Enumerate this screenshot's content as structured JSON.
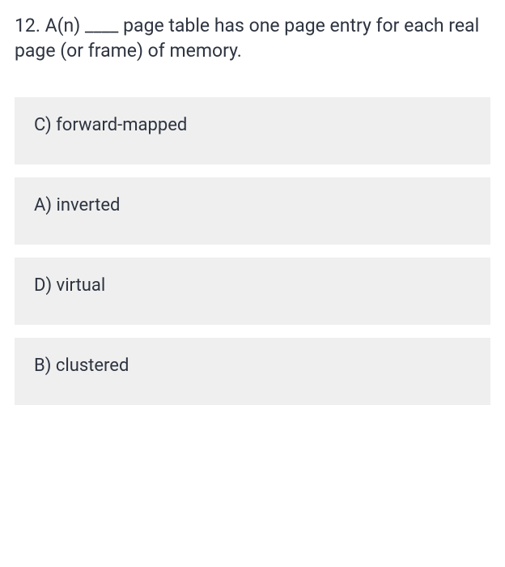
{
  "question": {
    "number": "12.",
    "text": "A(n) ____ page table has one page entry for each real page (or frame) of memory."
  },
  "options": [
    {
      "label": "C) forward-mapped"
    },
    {
      "label": "A) inverted"
    },
    {
      "label": "D) virtual"
    },
    {
      "label": "B) clustered"
    }
  ]
}
